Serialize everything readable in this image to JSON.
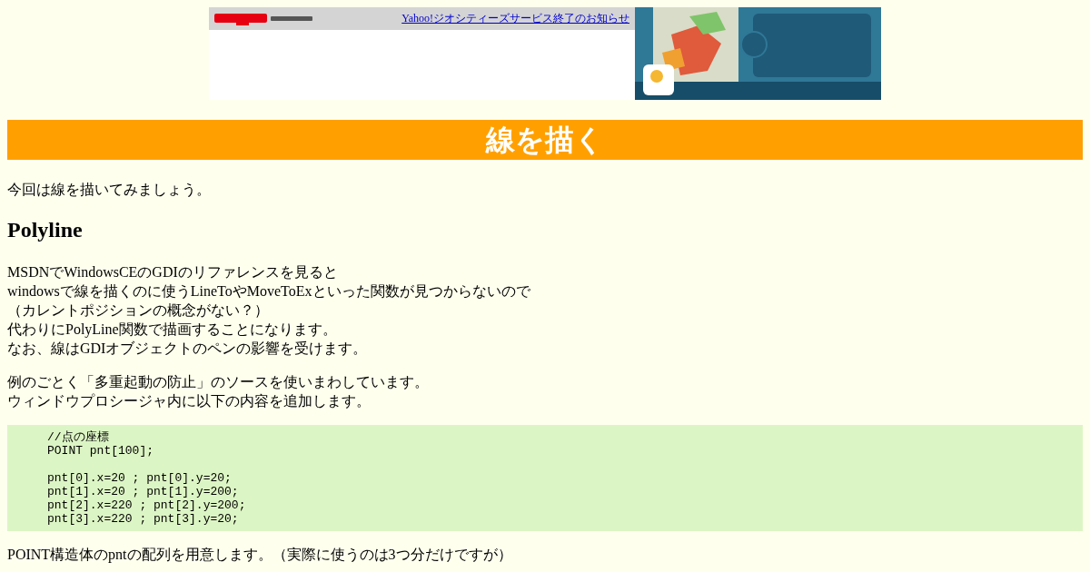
{
  "banner": {
    "link": "Yahoo!ジオシティーズサービス終了のお知らせ"
  },
  "title": "線を描く",
  "intro": "今回は線を描いてみましょう。",
  "section_heading": "Polyline",
  "paragraphs": [
    [
      "MSDNでWindowsCEのGDIのリファレンスを見ると",
      "windowsで線を描くのに使うLineToやMoveToExといった関数が見つからないので",
      "（カレントポジションの概念がない？）",
      "代わりにPolyLine関数で描画することになります。",
      "なお、線はGDIオブジェクトのペンの影響を受けます。"
    ],
    [
      "例のごとく「多重起動の防止」のソースを使いまわしています。",
      "ウィンドウプロシージャ内に以下の内容を追加します。"
    ]
  ],
  "code": [
    [
      "//点の座標",
      "POINT pnt[100];"
    ],
    [
      "pnt[0].x=20 ; pnt[0].y=20;",
      "pnt[1].x=20 ; pnt[1].y=200;",
      "pnt[2].x=220 ; pnt[2].y=200;",
      "pnt[3].x=220 ; pnt[3].y=20;"
    ]
  ],
  "after": [
    "POINT構造体のpntの配列を用意します。（実際に使うのは3つ分だけですが）"
  ]
}
